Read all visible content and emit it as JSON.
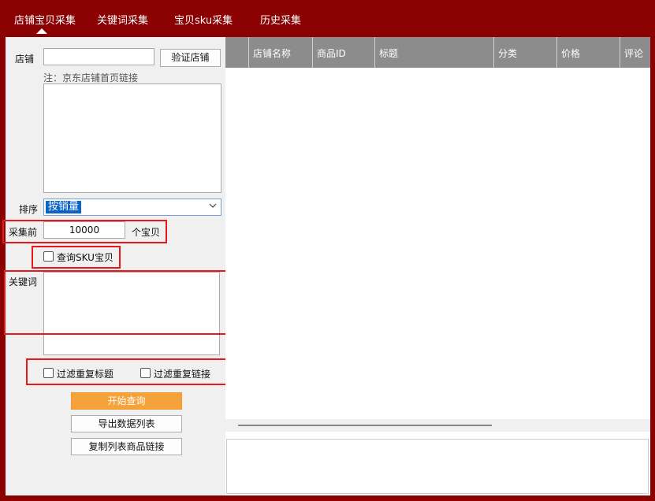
{
  "nav": {
    "tabs": [
      {
        "label": "店铺宝贝采集",
        "active": true
      },
      {
        "label": "关键词采集"
      },
      {
        "label": "宝贝sku采集"
      },
      {
        "label": "历史采集"
      }
    ]
  },
  "form": {
    "store_label": "店铺",
    "store_input_value": "",
    "verify_button": "验证店铺",
    "store_note": "注：京东店铺首页链接",
    "sort_label": "排序",
    "sort_value": "按销量",
    "collect_prefix": "采集前",
    "collect_count": "10000",
    "collect_suffix": "个宝贝",
    "query_sku_label": "查询SKU宝贝",
    "keyword_label": "关键词",
    "filter_title_label": "过滤重复标题",
    "filter_link_label": "过滤重复链接",
    "start_button": "开始查询",
    "export_button": "导出数据列表",
    "copy_button": "复制列表商品链接"
  },
  "grid": {
    "columns": [
      "店铺名称",
      "商品ID",
      "标题",
      "分类",
      "价格",
      "评论"
    ]
  },
  "colors": {
    "brand": "#8b0000",
    "panel": "#f0f0f0",
    "grid_header": "#8c8c8c",
    "primary_button": "#f6a23b",
    "highlight_box": "#e41a1a",
    "selection": "#0a64c8"
  }
}
